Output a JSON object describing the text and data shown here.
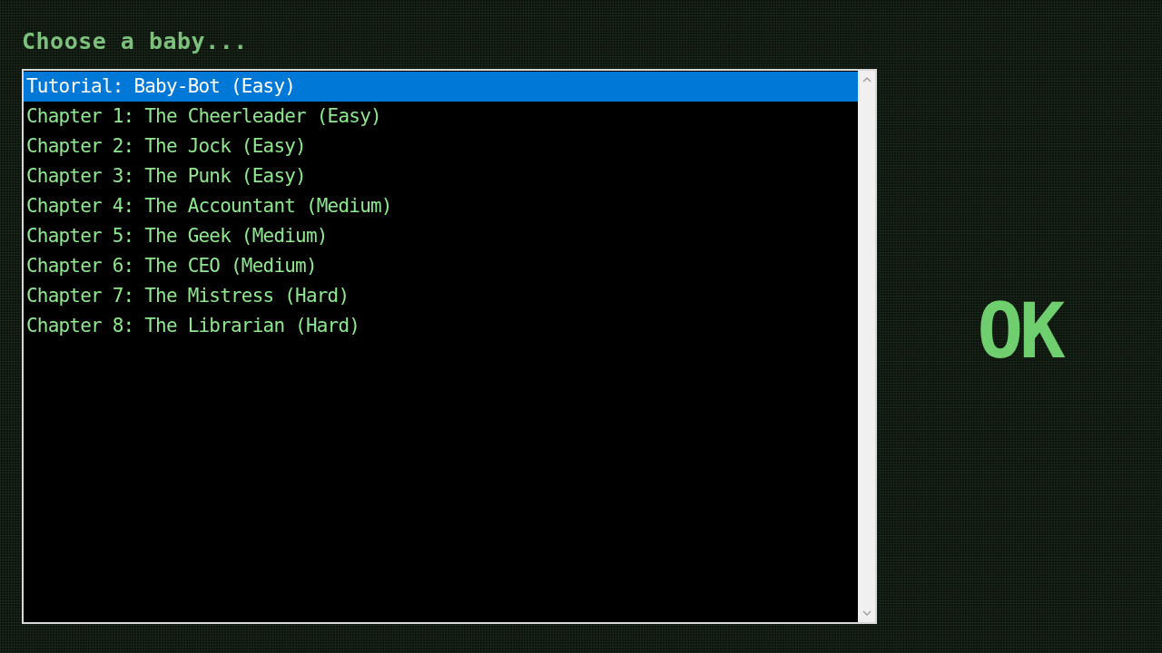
{
  "heading": "Choose a baby...",
  "levels": [
    {
      "label": "Tutorial: Baby-Bot (Easy)",
      "selected": true
    },
    {
      "label": "Chapter 1: The Cheerleader (Easy)",
      "selected": false
    },
    {
      "label": "Chapter 2: The Jock (Easy)",
      "selected": false
    },
    {
      "label": "Chapter 3: The Punk (Easy)",
      "selected": false
    },
    {
      "label": "Chapter 4: The Accountant (Medium)",
      "selected": false
    },
    {
      "label": "Chapter 5: The Geek (Medium)",
      "selected": false
    },
    {
      "label": "Chapter 6: The CEO (Medium)",
      "selected": false
    },
    {
      "label": "Chapter 7: The Mistress (Hard)",
      "selected": false
    },
    {
      "label": "Chapter 8: The Librarian (Hard)",
      "selected": false
    }
  ],
  "ok_button": "OK"
}
